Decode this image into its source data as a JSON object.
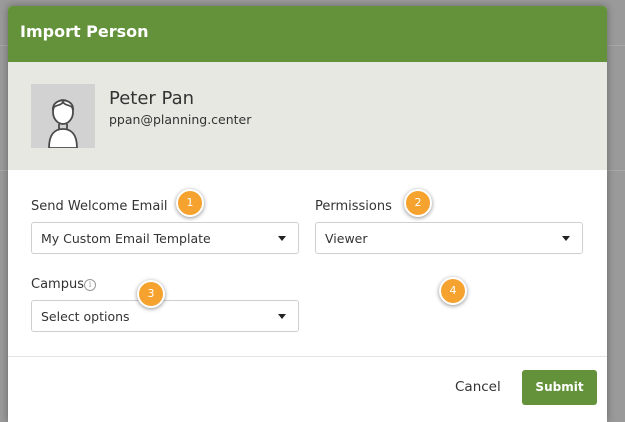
{
  "modal": {
    "title": "Import Person"
  },
  "person": {
    "name": "Peter Pan",
    "email": "ppan@planning.center"
  },
  "fields": {
    "welcome_email": {
      "label": "Send Welcome Email",
      "value": "My Custom Email Template"
    },
    "permissions": {
      "label": "Permissions",
      "value": "Viewer"
    },
    "campus": {
      "label": "Campus",
      "value": "Select options"
    }
  },
  "badges": [
    "1",
    "2",
    "3",
    "4"
  ],
  "actions": {
    "cancel_label": "Cancel",
    "submit_label": "Submit"
  },
  "colors": {
    "header": "#63923a",
    "submit": "#63923a",
    "badge": "#f5a22e",
    "person_band": "#e8e8e2"
  },
  "icons": {
    "avatar": "person-silhouette-icon",
    "info": "info-icon",
    "caret": "chevron-down-icon"
  }
}
